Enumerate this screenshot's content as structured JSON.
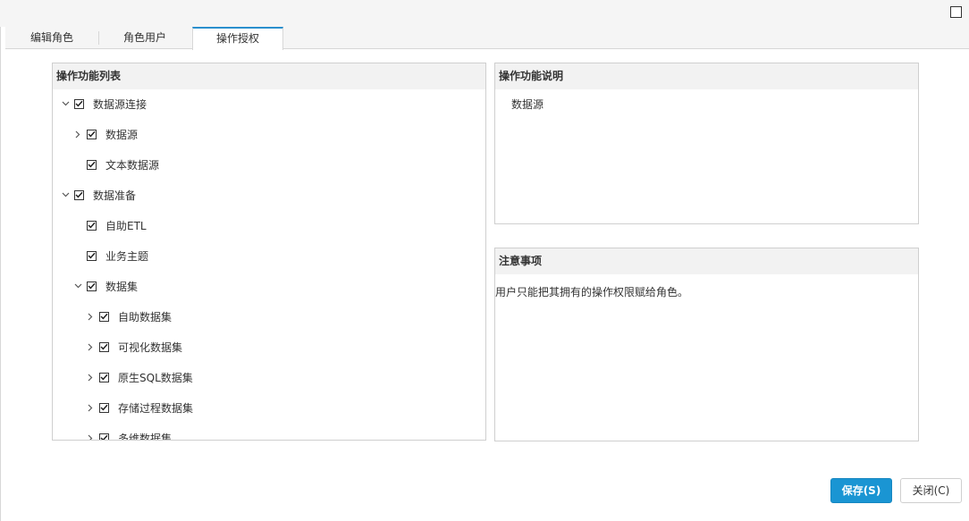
{
  "tabs": [
    {
      "label": "编辑角色",
      "active": false
    },
    {
      "label": "角色用户",
      "active": false
    },
    {
      "label": "操作授权",
      "active": true
    }
  ],
  "ops_list": {
    "title": "操作功能列表",
    "items": [
      {
        "label": "数据源连接",
        "level": 0,
        "toggle": "expanded",
        "checked": true
      },
      {
        "label": "数据源",
        "level": 1,
        "toggle": "collapsed",
        "checked": true
      },
      {
        "label": "文本数据源",
        "level": 1,
        "toggle": "none",
        "checked": true
      },
      {
        "label": "数据准备",
        "level": 0,
        "toggle": "expanded",
        "checked": true
      },
      {
        "label": "自助ETL",
        "level": 1,
        "toggle": "none",
        "checked": true
      },
      {
        "label": "业务主题",
        "level": 1,
        "toggle": "none",
        "checked": true
      },
      {
        "label": "数据集",
        "level": 1,
        "toggle": "expanded",
        "checked": true
      },
      {
        "label": "自助数据集",
        "level": 2,
        "toggle": "collapsed",
        "checked": true
      },
      {
        "label": "可视化数据集",
        "level": 2,
        "toggle": "collapsed",
        "checked": true
      },
      {
        "label": "原生SQL数据集",
        "level": 2,
        "toggle": "collapsed",
        "checked": true
      },
      {
        "label": "存储过程数据集",
        "level": 2,
        "toggle": "collapsed",
        "checked": true
      },
      {
        "label": "多维数据集",
        "level": 2,
        "toggle": "collapsed",
        "checked": true
      }
    ]
  },
  "description": {
    "title": "操作功能说明",
    "text": "数据源"
  },
  "notes": {
    "title": "注意事项",
    "text": "用户只能把其拥有的操作权限赋给角色。"
  },
  "buttons": {
    "save": "保存(S)",
    "close": "关闭(C)"
  },
  "colors": {
    "accent": "#1a95d3",
    "active_tab_border": "#2a8fcd"
  }
}
